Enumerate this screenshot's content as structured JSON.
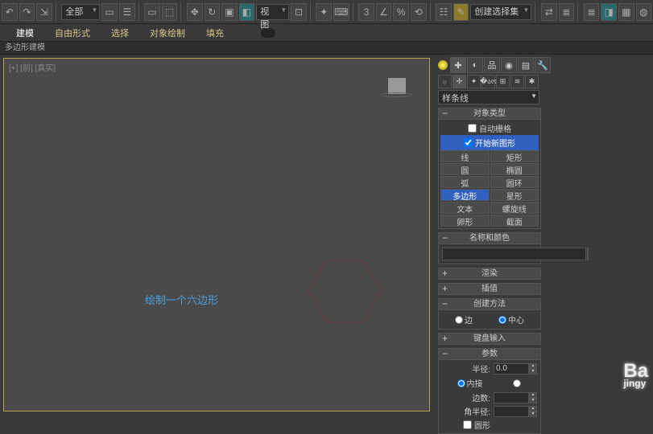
{
  "toolbar": {
    "filter_dropdown": "全部",
    "view_btn": "视图",
    "angle_icon": "3",
    "create_sel_set": "创建选择集"
  },
  "menu": {
    "modeling": "建模",
    "freeform": "自由形式",
    "select": "选择",
    "object_paint": "对象绘制",
    "fill": "填充"
  },
  "mode_label": "多边形建模",
  "viewport": {
    "label": "[+] [前] [真实]",
    "annotation": "绘制一个六边形"
  },
  "panel": {
    "category": "样条线",
    "rollouts": {
      "object_type": "对象类型",
      "name_color": "名称和颜色",
      "render": "渲染",
      "interp": "插值",
      "create_method": "创建方法",
      "keyboard": "键盘输入",
      "params": "参数"
    },
    "auto_grid": "自动栅格",
    "start_new": "开始新图形",
    "types": {
      "line": "线",
      "rect": "矩形",
      "circle": "圆",
      "ellipse": "椭圆",
      "arc": "弧",
      "donut": "圆环",
      "ngon": "多边形",
      "star": "星形",
      "text": "文本",
      "helix": "螺旋线",
      "egg": "卵形",
      "section": "截面"
    },
    "method": {
      "edge": "边",
      "center": "中心"
    },
    "params_fields": {
      "radius": "半径:",
      "radius_val": "0.0",
      "inscribed": "内接",
      "circumscribed": "",
      "sides": "边数:",
      "sides_val": "",
      "corner_radius": "角半径:",
      "corner_radius_val": "",
      "circular": "圆形"
    }
  },
  "watermark": {
    "brand": "Ba",
    "sub": "jingy"
  }
}
